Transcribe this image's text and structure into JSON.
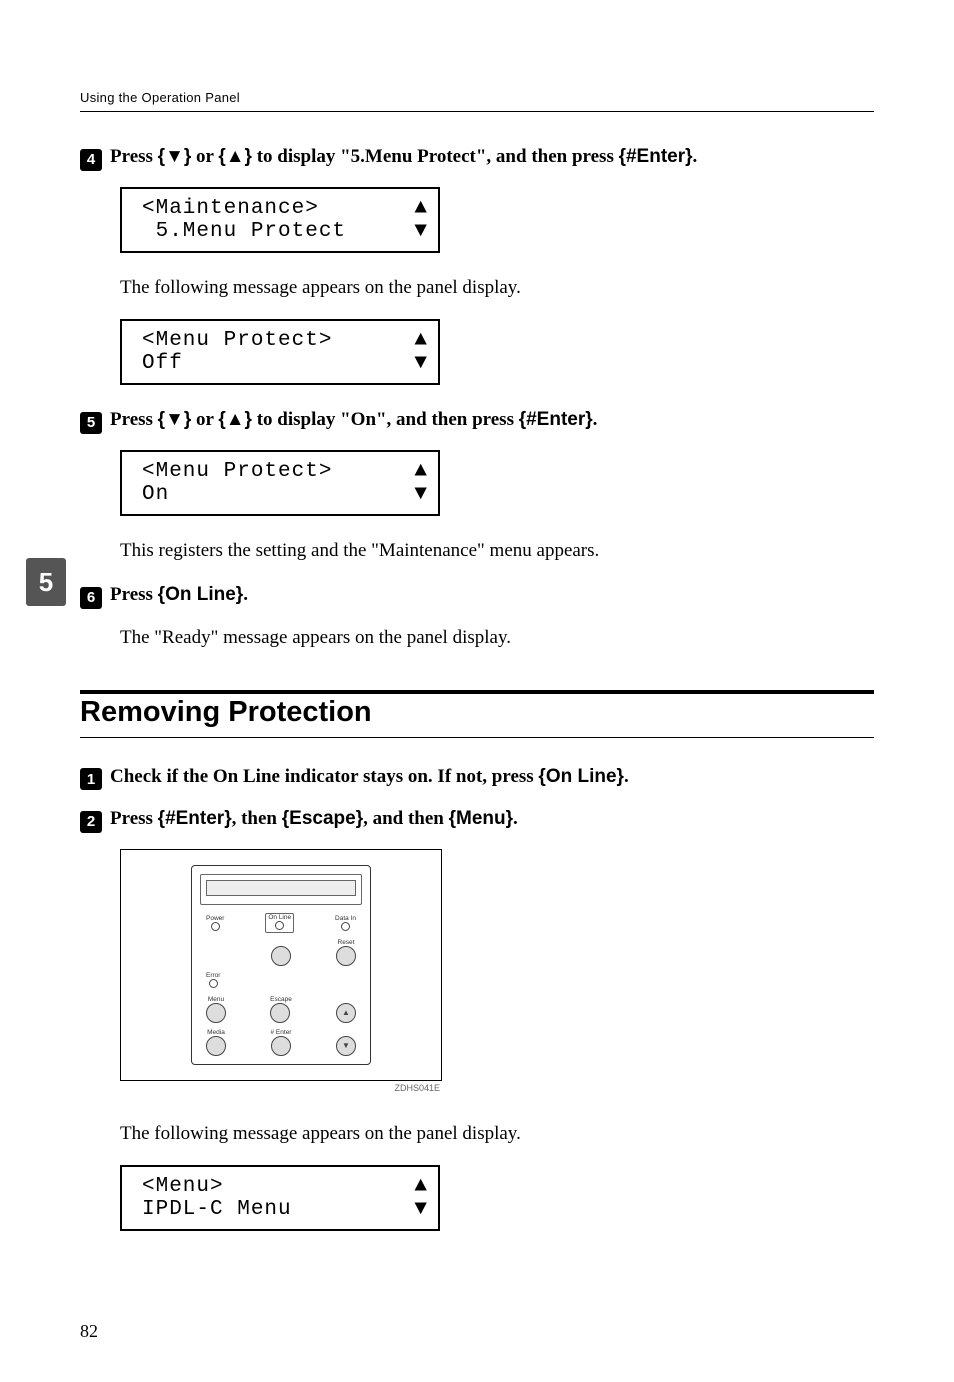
{
  "runningHead": "Using the Operation Panel",
  "sideTab": "5",
  "step4": {
    "num": "4",
    "pre": "Press ",
    "k1": "{▼}",
    "mid1": " or ",
    "k2": "{▲}",
    "mid2": " to display \"5.Menu Protect\", and then press ",
    "k3": "{#Enter}",
    "post": "."
  },
  "lcd4a": {
    "l1": "<Maintenance>",
    "a1": "▲",
    "l2": " 5.Menu Protect",
    "a2": "▼"
  },
  "following1": "The following message appears on the panel display.",
  "lcd4b": {
    "l1": "<Menu Protect>",
    "a1": "▲",
    "l2": "Off",
    "a2": "▼"
  },
  "step5": {
    "num": "5",
    "pre": "Press ",
    "k1": "{▼}",
    "mid1": " or ",
    "k2": "{▲}",
    "mid2": " to display \"On\", and then press ",
    "k3": "{#Enter}",
    "post": "."
  },
  "lcd5": {
    "l1": "<Menu Protect>",
    "a1": "▲",
    "l2": "On",
    "a2": "▼"
  },
  "registers": "This registers the setting and the \"Maintenance\" menu appears.",
  "step6": {
    "num": "6",
    "pre": "Press ",
    "k1": "{On Line}",
    "post": "."
  },
  "readyMsg": "The \"Ready\" message appears on the panel display.",
  "heading": "Removing Protection",
  "step1": {
    "num": "1",
    "pre": "Check if the On Line indicator stays on. If not, press ",
    "k1": "{On Line}",
    "post": "."
  },
  "step2": {
    "num": "2",
    "pre": "Press ",
    "k1": "{#Enter}",
    "mid1": ", then ",
    "k2": "{Escape}",
    "mid2": ", and then ",
    "k3": "{Menu}",
    "post": "."
  },
  "figCode": "ZDHS041E",
  "following2": "The following message appears on the panel display.",
  "lcdMenu": {
    "l1": "<Menu>",
    "a1": "▲",
    "l2": "IPDL-C Menu",
    "a2": "▼"
  },
  "panelLabels": {
    "power": "Power",
    "online": "On Line",
    "datain": "Data In",
    "reset": "Reset",
    "error": "Error",
    "menu": "Menu",
    "escape": "Escape",
    "media": "Media",
    "enter": "# Enter"
  },
  "pageNum": "82"
}
